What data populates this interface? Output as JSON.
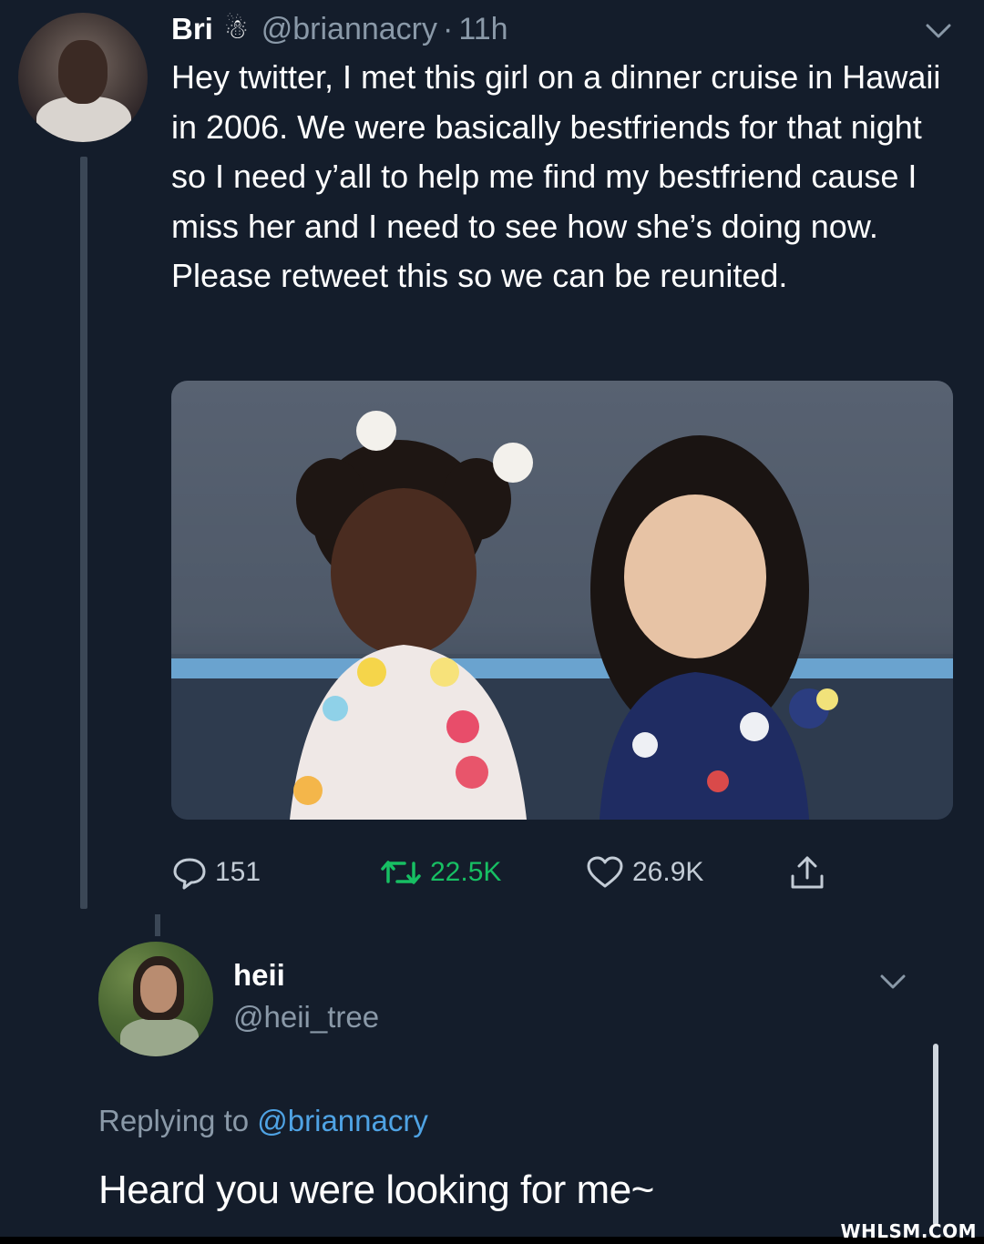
{
  "main_tweet": {
    "name": "Bri",
    "emoji": "☃",
    "handle": "@briannacry",
    "separator": "·",
    "time": "11h",
    "text": "Hey twitter, I met this girl on a dinner cruise in Hawaii in 2006. We were basically bestfriends for that night so I need y’all to help me find my bestfriend cause I miss her and I need to see how she’s doing now. Please retweet this so we can be reunited.",
    "actions": {
      "reply_count": "151",
      "retweet_count": "22.5K",
      "like_count": "26.9K"
    },
    "colors": {
      "retweet": "#17bf63",
      "link": "#4fa3e4",
      "background": "#141d2b"
    }
  },
  "reply_tweet": {
    "name": "heii",
    "handle": "@heii_tree",
    "replying_prefix": "Replying to",
    "replying_handle": "@briannacry",
    "text": "Heard you were looking for me~"
  },
  "watermark": "WHLSM.COM",
  "icons": [
    "reply-icon",
    "retweet-icon",
    "heart-icon",
    "share-icon",
    "chevron-down-icon"
  ]
}
